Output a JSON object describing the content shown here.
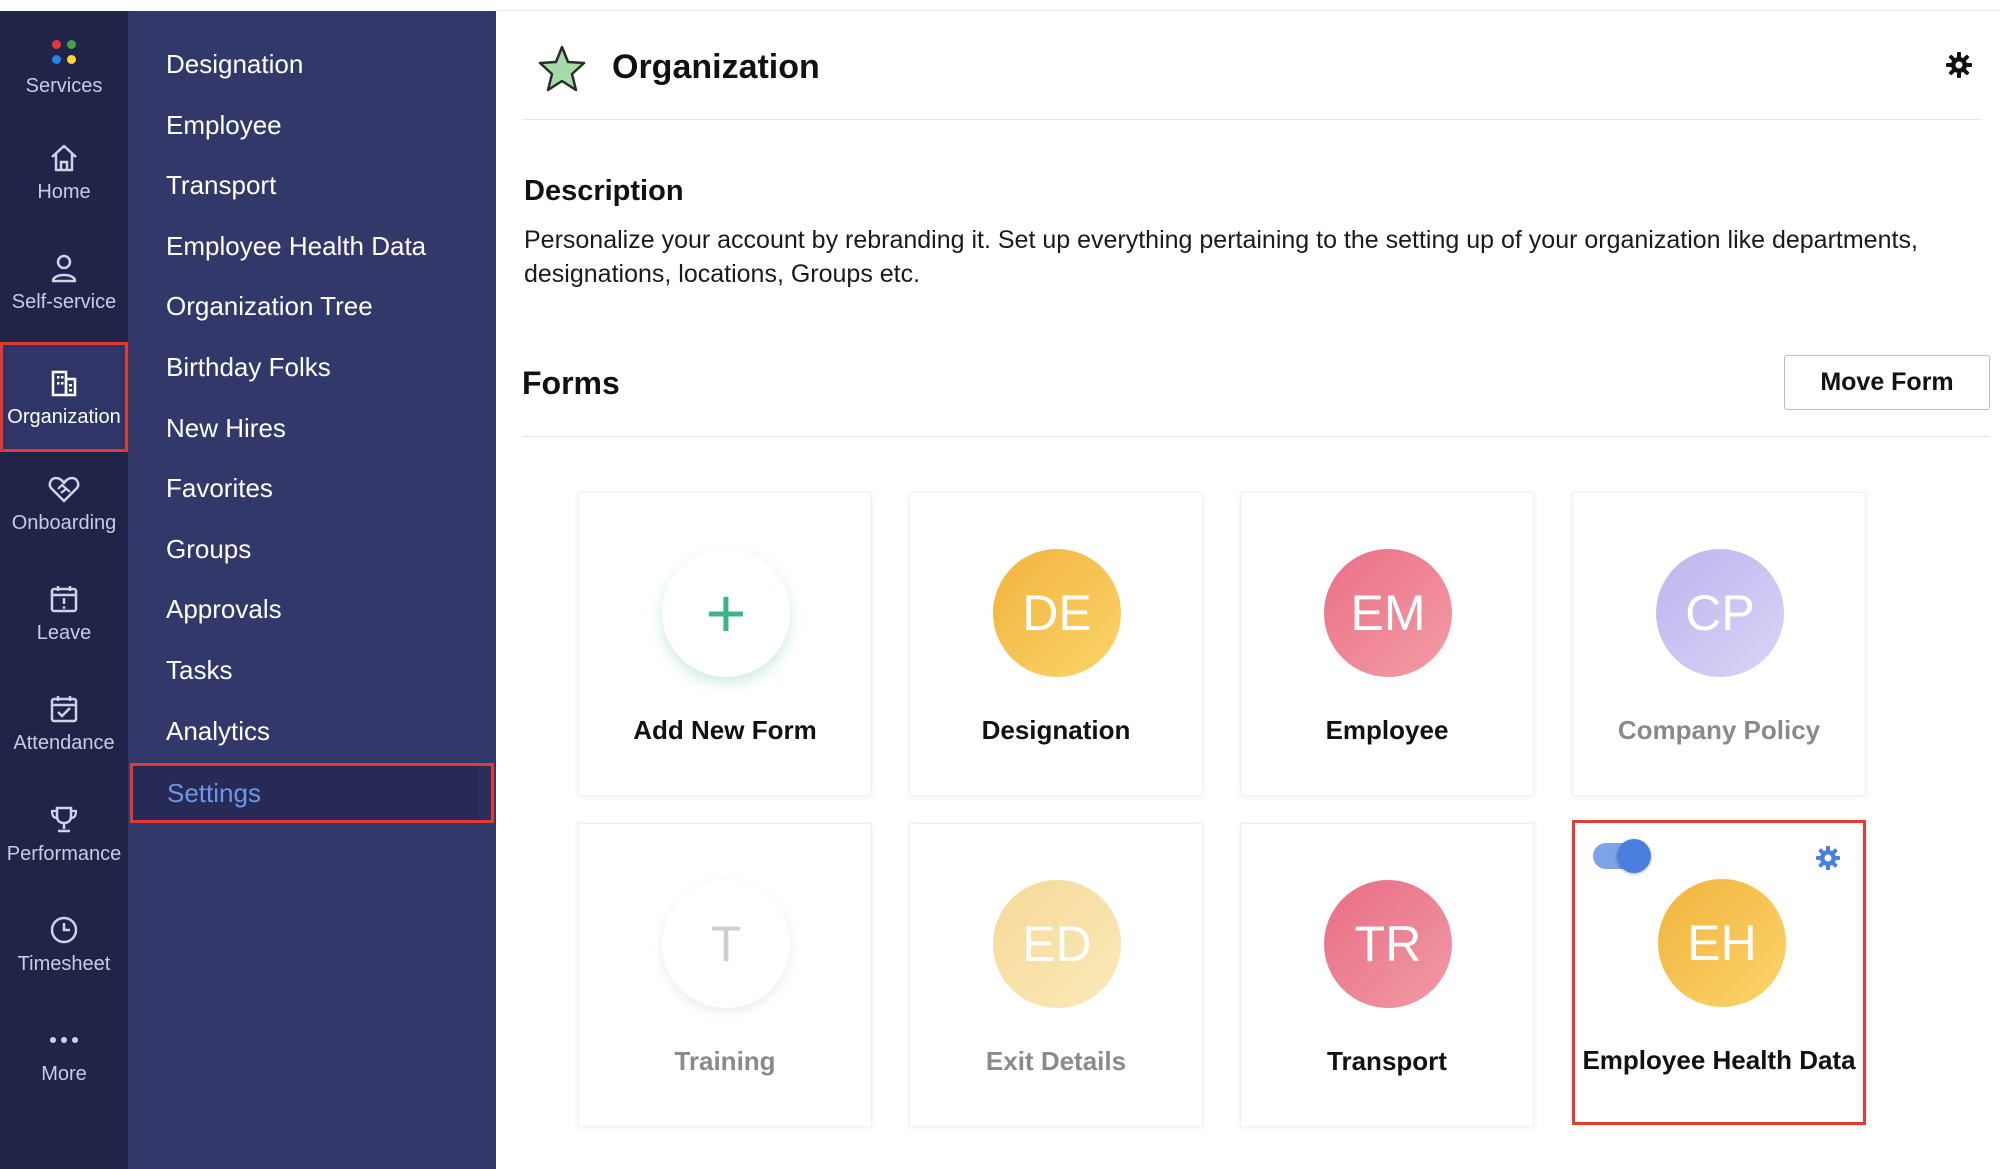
{
  "rail": {
    "items": [
      {
        "label": "Services",
        "icon": "services-dots-icon"
      },
      {
        "label": "Home",
        "icon": "home-icon"
      },
      {
        "label": "Self-service",
        "icon": "person-icon"
      },
      {
        "label": "Organization",
        "icon": "building-icon",
        "active": true
      },
      {
        "label": "Onboarding",
        "icon": "handshake-icon"
      },
      {
        "label": "Leave",
        "icon": "calendar-alert-icon"
      },
      {
        "label": "Attendance",
        "icon": "calendar-check-icon"
      },
      {
        "label": "Performance",
        "icon": "trophy-icon"
      },
      {
        "label": "Timesheet",
        "icon": "clock-icon"
      },
      {
        "label": "More",
        "icon": "more-dots-icon"
      }
    ],
    "dot_colors": [
      "#e53935",
      "#43a047",
      "#1e88e5",
      "#fdd835"
    ]
  },
  "subnav": {
    "items": [
      "Designation",
      "Employee",
      "Transport",
      "Employee Health Data",
      "Organization Tree",
      "Birthday Folks",
      "New Hires",
      "Favorites",
      "Groups",
      "Approvals",
      "Tasks",
      "Analytics"
    ],
    "settings_label": "Settings"
  },
  "header": {
    "title": "Organization"
  },
  "description": {
    "title": "Description",
    "text": "Personalize your account by rebranding it. Set up everything pertaining to the setting up of your organization like departments, designations, locations, Groups etc."
  },
  "forms": {
    "title": "Forms",
    "move_button": "Move Form",
    "cards": [
      {
        "initials": "+",
        "label": "Add New Form",
        "kind": "add"
      },
      {
        "initials": "DE",
        "label": "Designation",
        "gradient": [
          "#f2b33d",
          "#fbd46b"
        ]
      },
      {
        "initials": "EM",
        "label": "Employee",
        "gradient": [
          "#ea6f86",
          "#f49da6"
        ]
      },
      {
        "initials": "CP",
        "label": "Company Policy",
        "gradient": [
          "#bcb6ee",
          "#d9d4f7"
        ],
        "disabled": true
      },
      {
        "initials": "T",
        "label": "Training",
        "gradient": [
          "#ffffff",
          "#ffffff"
        ],
        "disabled": true
      },
      {
        "initials": "ED",
        "label": "Exit Details",
        "gradient": [
          "#f6d89a",
          "#faeab8"
        ],
        "disabled": true
      },
      {
        "initials": "TR",
        "label": "Transport",
        "gradient": [
          "#e86d86",
          "#f19aa4"
        ]
      },
      {
        "initials": "EH",
        "label": "Employee Health Data",
        "gradient": [
          "#f2b33d",
          "#fbd46b"
        ],
        "selected": true,
        "toggle_on": true
      }
    ]
  },
  "colors": {
    "rail_bg": "#202449",
    "subnav_bg": "#33386a",
    "highlight": "#e53935",
    "link_blue": "#6f95e6",
    "accent_green": "#3db388"
  }
}
